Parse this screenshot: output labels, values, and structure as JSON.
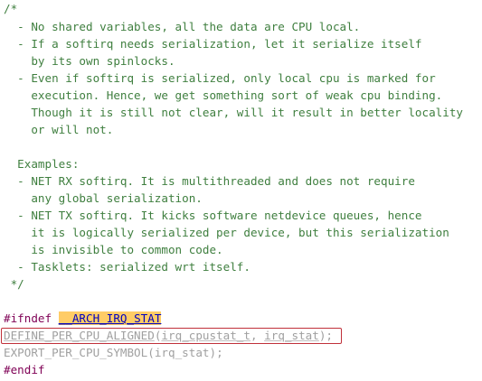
{
  "code": {
    "comment_lines": [
      "/*",
      "  - No shared variables, all the data are CPU local.",
      "  - If a softirq needs serialization, let it serialize itself",
      "    by its own spinlocks.",
      "  - Even if softirq is serialized, only local cpu is marked for",
      "    execution. Hence, we get something sort of weak cpu binding.",
      "    Though it is still not clear, will it result in better locality",
      "    or will not.",
      "",
      "  Examples:",
      "  - NET RX softirq. It is multithreaded and does not require",
      "    any global serialization.",
      "  - NET TX softirq. It kicks software netdevice queues, hence",
      "    it is logically serialized per device, but this serialization",
      "    is invisible to common code.",
      "  - Tasklets: serialized wrt itself.",
      " */"
    ],
    "ifndef_keyword": "#ifndef",
    "ifndef_macro": "__ARCH_IRQ_STAT",
    "define_line": {
      "macro": "DEFINE_PER_CPU_ALIGNED",
      "open": "(",
      "arg1": "irq_cpustat_t",
      "sep": ", ",
      "arg2": "irq_stat",
      "close": ");"
    },
    "export_line": {
      "macro": "EXPORT_PER_CPU_SYMBOL",
      "open": "(",
      "arg": "irq_stat",
      "close": ");"
    },
    "endif_keyword": "#endif"
  },
  "colors": {
    "comment": "#3f7f3f",
    "keyword": "#7f0055",
    "inactive_code": "#a0a0a0",
    "macro_highlight_bg": "#ffcc66",
    "annotation_box": "#c0303a"
  }
}
